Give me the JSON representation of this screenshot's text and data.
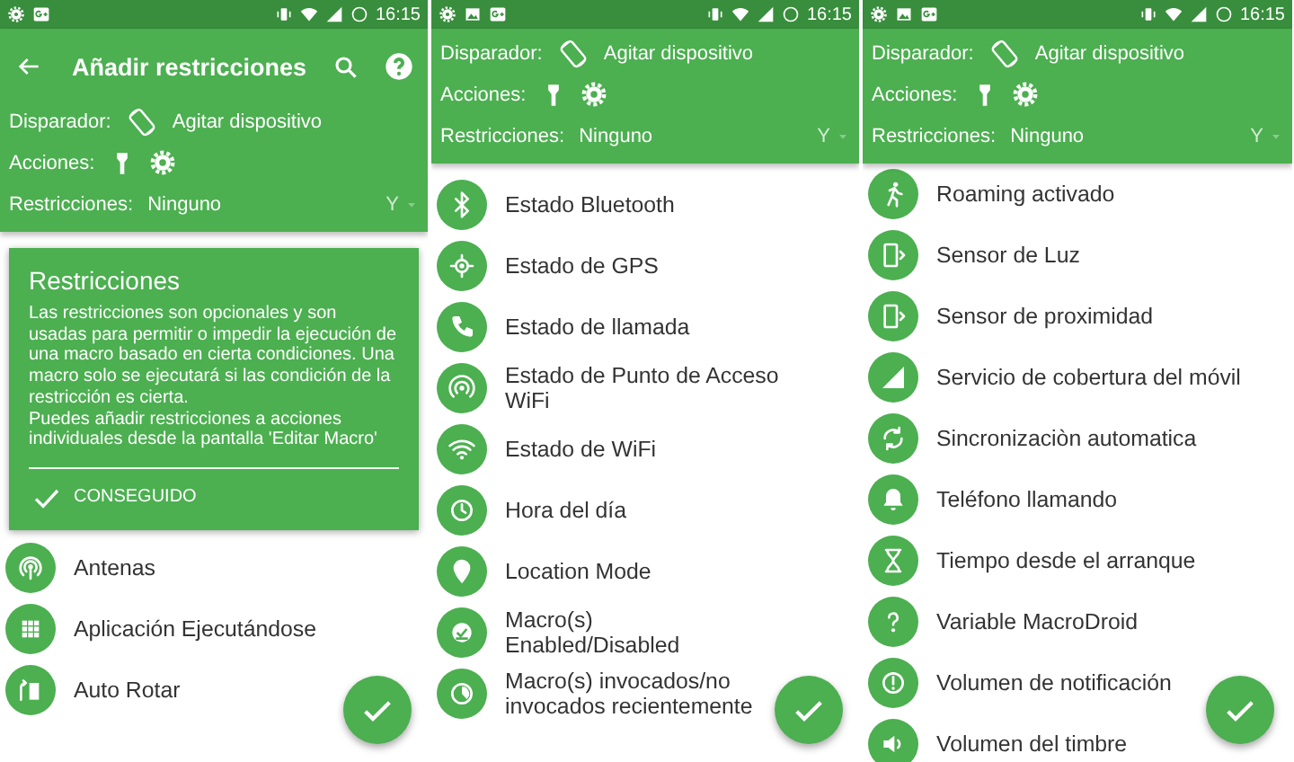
{
  "screens": [
    {
      "status_bar": {
        "notification_icons": [
          {
            "kind": "gear"
          },
          {
            "kind": "gplus"
          }
        ],
        "time": "16:15"
      },
      "app_bar": {
        "title": "Añadir restricciones"
      },
      "macro_summary": {
        "trigger_label": "Disparador:",
        "trigger_value": "Agitar dispositivo",
        "actions_label": "Acciones:",
        "restrictions_label": "Restricciones:",
        "restrictions_value": "Ninguno",
        "logic": "Y"
      },
      "info_card": {
        "title": "Restricciones",
        "body": "Las restricciones son opcionales y son usadas para permitir o impedir la ejecución de una macro basado en cierta condiciones. Una macro solo se ejecutará si las condición de la restricción es cierta.\nPuedes añadir restricciones a acciones individuales desde la pantalla 'Editar Macro'",
        "button": "CONSEGUIDO"
      },
      "items": [
        {
          "label": "Antenas",
          "kind": "antenna"
        },
        {
          "label": "Aplicación Ejecutándose",
          "kind": "grid"
        },
        {
          "label": "Auto Rotar",
          "kind": "rotate"
        }
      ]
    },
    {
      "status_bar": {
        "notification_icons": [
          {
            "kind": "gear"
          },
          {
            "kind": "image"
          },
          {
            "kind": "gplus"
          }
        ],
        "time": "16:15"
      },
      "macro_summary": {
        "trigger_label": "Disparador:",
        "trigger_value": "Agitar dispositivo",
        "actions_label": "Acciones:",
        "restrictions_label": "Restricciones:",
        "restrictions_value": "Ninguno",
        "logic": "Y"
      },
      "items": [
        {
          "label": "Estado Bluetooth",
          "kind": "bluetooth"
        },
        {
          "label": "Estado de GPS",
          "kind": "gps"
        },
        {
          "label": "Estado de llamada",
          "kind": "phone"
        },
        {
          "label": "Estado de Punto de Acceso WiFi",
          "kind": "hotspot"
        },
        {
          "label": "Estado de WiFi",
          "kind": "wifi"
        },
        {
          "label": "Hora del día",
          "kind": "clock"
        },
        {
          "label": "Location Mode",
          "kind": "pin"
        },
        {
          "label": "Macro(s) Enabled/Disabled",
          "kind": "check"
        },
        {
          "label": "Macro(s) invocados/no invocados recientemente",
          "kind": "timer"
        }
      ]
    },
    {
      "status_bar": {
        "notification_icons": [
          {
            "kind": "gear"
          },
          {
            "kind": "image"
          },
          {
            "kind": "gplus"
          }
        ],
        "time": "16:15"
      },
      "macro_summary": {
        "trigger_label": "Disparador:",
        "trigger_value": "Agitar dispositivo",
        "actions_label": "Acciones:",
        "restrictions_label": "Restricciones:",
        "restrictions_value": "Ninguno",
        "logic": "Y"
      },
      "items": [
        {
          "label": "Roaming activado",
          "kind": "run"
        },
        {
          "label": "Sensor de Luz",
          "kind": "phone-arrow"
        },
        {
          "label": "Sensor de proximidad",
          "kind": "phone-arrow"
        },
        {
          "label": "Servicio de cobertura del móvil",
          "kind": "signal"
        },
        {
          "label": "Sincronizaciòn automatica",
          "kind": "sync"
        },
        {
          "label": "Teléfono llamando",
          "kind": "bell"
        },
        {
          "label": "Tiempo desde el arranque",
          "kind": "hourglass"
        },
        {
          "label": "Variable MacroDroid",
          "kind": "question"
        },
        {
          "label": "Volumen de notificación",
          "kind": "alert"
        },
        {
          "label": "Volumen del timbre",
          "kind": "speaker"
        }
      ]
    }
  ]
}
